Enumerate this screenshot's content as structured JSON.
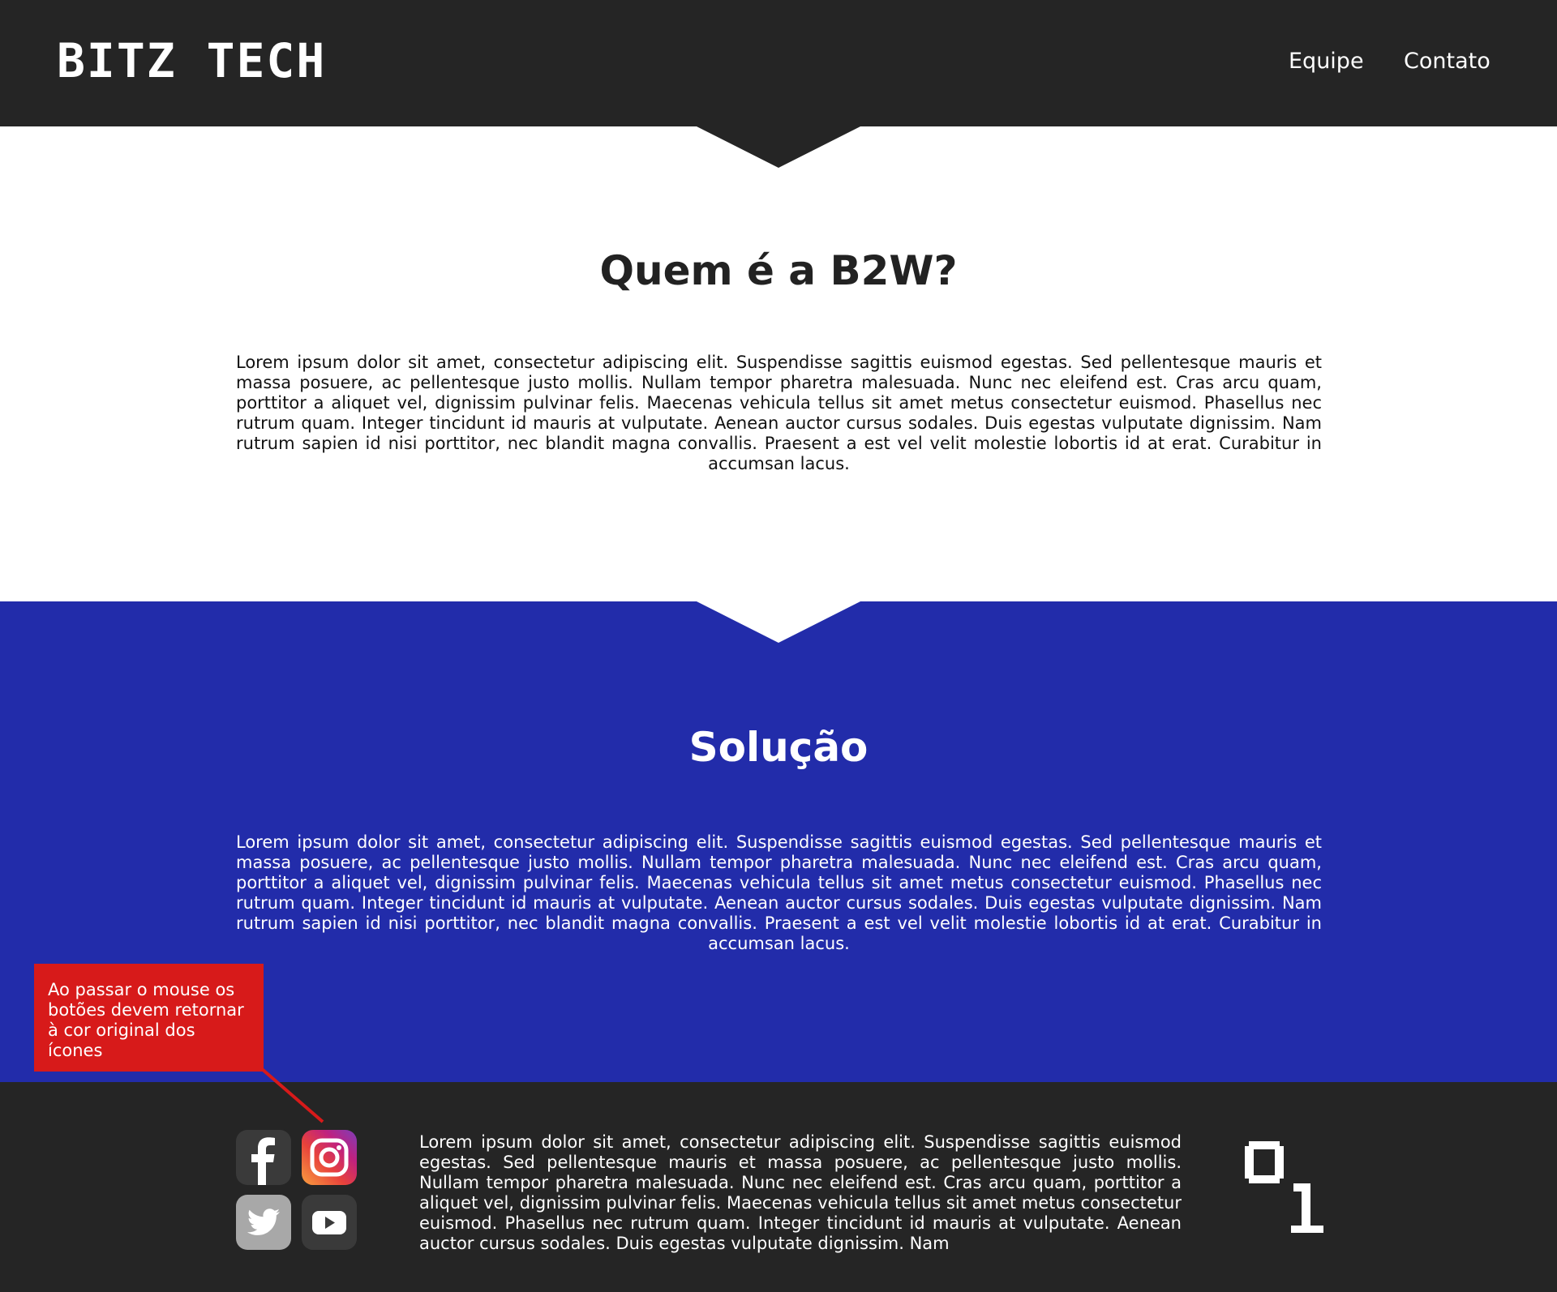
{
  "header": {
    "logo": "BITZ TECH",
    "nav": [
      {
        "label": "Equipe"
      },
      {
        "label": "Contato"
      }
    ]
  },
  "section_about": {
    "title": "Quem é a B2W?",
    "body": "Lorem ipsum dolor sit amet, consectetur adipiscing elit. Suspendisse sagittis euismod egestas. Sed pellentesque mauris et massa posuere, ac pellentesque justo mollis. Nullam tempor pharetra malesuada. Nunc nec eleifend est. Cras arcu quam, porttitor a aliquet vel, dignissim pulvinar felis. Maecenas vehicula tellus sit amet metus consectetur euismod. Phasellus nec rutrum quam. Integer tincidunt id mauris at vulputate. Aenean auctor cursus sodales. Duis egestas vulputate dignissim. Nam rutrum sapien id nisi porttitor, nec blandit magna convallis. Praesent a est vel velit molestie lobortis id at erat. Curabitur in accumsan lacus."
  },
  "section_solution": {
    "title": "Solução",
    "body": "Lorem ipsum dolor sit amet, consectetur adipiscing elit. Suspendisse sagittis euismod egestas. Sed pellentesque mauris et massa posuere, ac pellentesque justo mollis. Nullam tempor pharetra malesuada. Nunc nec eleifend est. Cras arcu quam, porttitor a aliquet vel, dignissim pulvinar felis. Maecenas vehicula tellus sit amet metus consectetur euismod. Phasellus nec rutrum quam. Integer tincidunt id mauris at vulputate. Aenean auctor cursus sodales. Duis egestas vulputate dignissim. Nam rutrum sapien id nisi porttitor, nec blandit magna convallis. Praesent a est vel velit molestie lobortis id at erat. Curabitur in accumsan lacus."
  },
  "annotation": {
    "text": "Ao passar o mouse os botões devem retornar à cor original dos ícones"
  },
  "footer": {
    "social_icons": [
      "facebook-icon",
      "instagram-icon",
      "twitter-icon",
      "youtube-icon"
    ],
    "text": "Lorem ipsum dolor sit amet, consectetur adipiscing elit. Suspendisse sagittis euismod egestas. Sed pellentesque mauris et massa posuere, ac pellentesque justo mollis. Nullam tempor pharetra malesuada. Nunc nec eleifend est. Cras arcu quam, porttitor a aliquet vel, dignissim pulvinar felis. Maecenas vehicula tellus sit amet metus consectetur euismod. Phasellus nec rutrum quam. Integer tincidunt id mauris at vulputate. Aenean auctor cursus sodales. Duis egestas vulputate dignissim. Nam",
    "logo_mark": "01"
  },
  "colors": {
    "header_bg": "#252525",
    "solution_bg": "#222caa",
    "footer_bg": "#252525",
    "annotation_bg": "#d71a1a"
  }
}
